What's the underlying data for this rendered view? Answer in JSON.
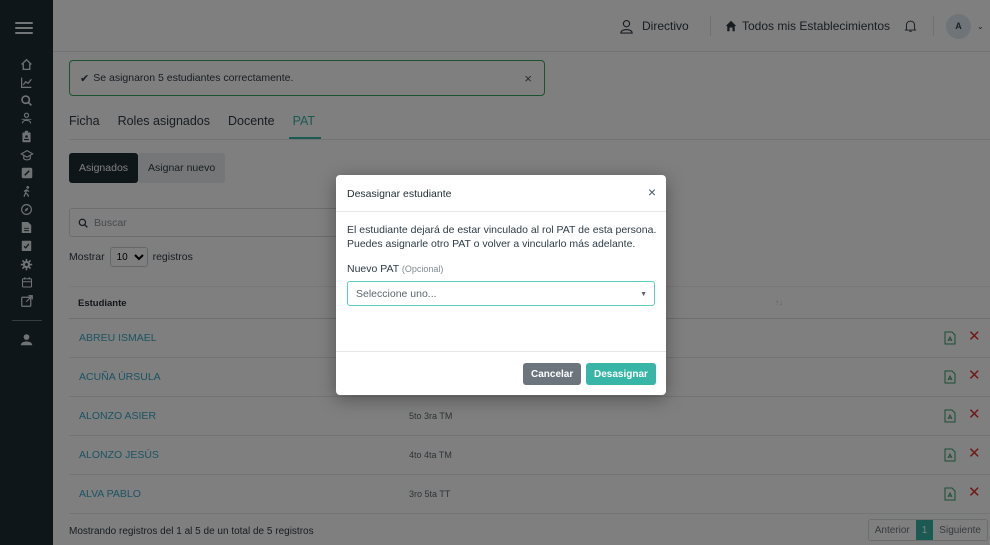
{
  "topbar": {
    "role": "Directivo",
    "establishment": "Todos mis Establecimientos",
    "avatar_initial": "A"
  },
  "sidebar": {
    "icons": [
      "home-icon",
      "chart-icon",
      "search-icon",
      "people-icon",
      "badge-icon",
      "graduation-icon",
      "edit-icon",
      "walker-icon",
      "compass-icon",
      "document-icon",
      "clipboard-icon",
      "gear-icon",
      "calendar-icon",
      "external-link-icon",
      "user-icon"
    ]
  },
  "alert": {
    "message": "Se asignaron 5 estudiantes correctamente."
  },
  "tabs": [
    {
      "label": "Ficha"
    },
    {
      "label": "Roles asignados"
    },
    {
      "label": "Docente"
    },
    {
      "label": "PAT"
    }
  ],
  "pills": {
    "assigned": "Asignados",
    "assign_new": "Asignar nuevo"
  },
  "search": {
    "placeholder": "Buscar"
  },
  "show": {
    "prefix": "Mostrar",
    "value": "10",
    "suffix": "registros"
  },
  "table": {
    "header_student": "Estudiante",
    "sort_indicator": "↑↓",
    "rows": [
      {
        "name": "ABREU ISMAEL",
        "course": ""
      },
      {
        "name": "ACUÑA ÚRSULA",
        "course": ""
      },
      {
        "name": "ALONZO ASIER",
        "course": "5to 3ra TM"
      },
      {
        "name": "ALONZO JESÚS",
        "course": "4to 4ta TM"
      },
      {
        "name": "ALVA PABLO",
        "course": "3ro 5ta TT"
      }
    ]
  },
  "footer": {
    "info": "Mostrando registros del 1 al 5 de un total de 5 registros",
    "prev": "Anterior",
    "current": "1",
    "next": "Siguiente"
  },
  "modal": {
    "title": "Desasignar estudiante",
    "text_1": "El estudiante dejará de estar vinculado al rol PAT de esta persona.",
    "text_2": "Puedes asignarle otro PAT o volver a vincularlo más adelante.",
    "field_label": "Nuevo PAT",
    "field_optional": "(Opcional)",
    "select_placeholder": "Seleccione uno...",
    "cancel": "Cancelar",
    "confirm": "Desasignar"
  },
  "colors": {
    "accent": "#37b5a6",
    "sidebar": "#1f2d32",
    "link": "#37a7c6",
    "danger": "#e03131",
    "success_border": "#3ba55c"
  }
}
